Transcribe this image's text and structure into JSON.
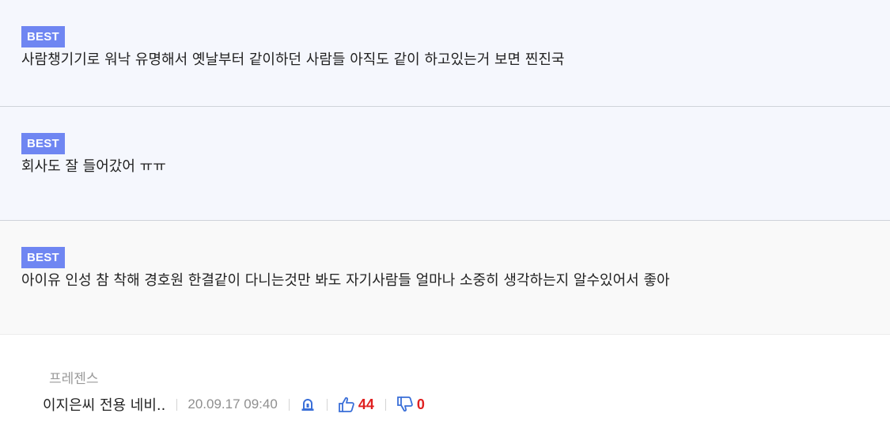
{
  "comments": [
    {
      "badge": "BEST",
      "text": "사람챙기기로 워낙 유명해서 옛날부터 같이하던 사람들 아직도 같이 하고있는거 보면 찐진국"
    },
    {
      "badge": "BEST",
      "text": "회사도 잘 들어갔어 ㅠㅠ"
    },
    {
      "badge": "BEST",
      "text": "아이유 인성 참 착해 경호원 한결같이 다니는것만 봐도 자기사람들 얼마나 소중히 생각하는지 알수있어서 좋아"
    }
  ],
  "post": {
    "category": "프레젠스",
    "title": "이지은씨 전용 네비..",
    "datetime": "20.09.17 09:40",
    "likes": "44",
    "dislikes": "0"
  },
  "colors": {
    "badge": "#6f86f2",
    "count": "#e02020",
    "icon": "#3a6fd8"
  },
  "icons": {
    "report": "siren-icon",
    "like": "thumbs-up-icon",
    "dislike": "thumbs-down-icon"
  }
}
